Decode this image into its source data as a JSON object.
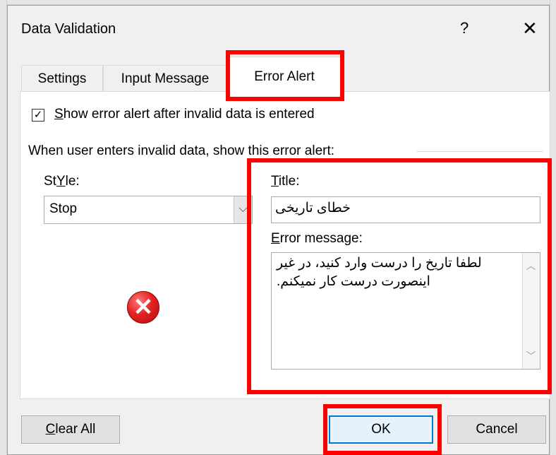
{
  "dialog": {
    "title": "Data Validation",
    "help_glyph": "?",
    "close_glyph": "✕"
  },
  "tabs": [
    {
      "label": "Settings",
      "active": false
    },
    {
      "label": "Input Message",
      "active": false
    },
    {
      "label": "Error Alert",
      "active": true
    }
  ],
  "show_error_alert": {
    "checked": true,
    "label_underlined": "S",
    "label_rest": "how error alert after invalid data is entered"
  },
  "group_label": "When user enters invalid data, show this error alert:",
  "style": {
    "label_underlined": "Y",
    "label_pre": "St",
    "label_post": "le:",
    "value": "Stop"
  },
  "title_field": {
    "label_underlined": "T",
    "label_rest": "itle:",
    "value": "خطای تاریخی"
  },
  "error_message": {
    "label_underlined": "E",
    "label_rest": "rror message:",
    "value": "لطفا تاریخ را درست وارد کنید، در غیر اینصورت درست کار نمیکنم."
  },
  "buttons": {
    "clear_all_underlined": "C",
    "clear_all_rest": "lear All",
    "ok": "OK",
    "cancel": "Cancel"
  },
  "colors": {
    "highlight": "#ff0000",
    "ok_border": "#0078d7"
  },
  "icons": [
    "stop-error-icon",
    "checkmark-icon",
    "dropdown-arrow-icon",
    "scroll-up-icon",
    "scroll-down-icon",
    "close-icon",
    "help-icon"
  ]
}
